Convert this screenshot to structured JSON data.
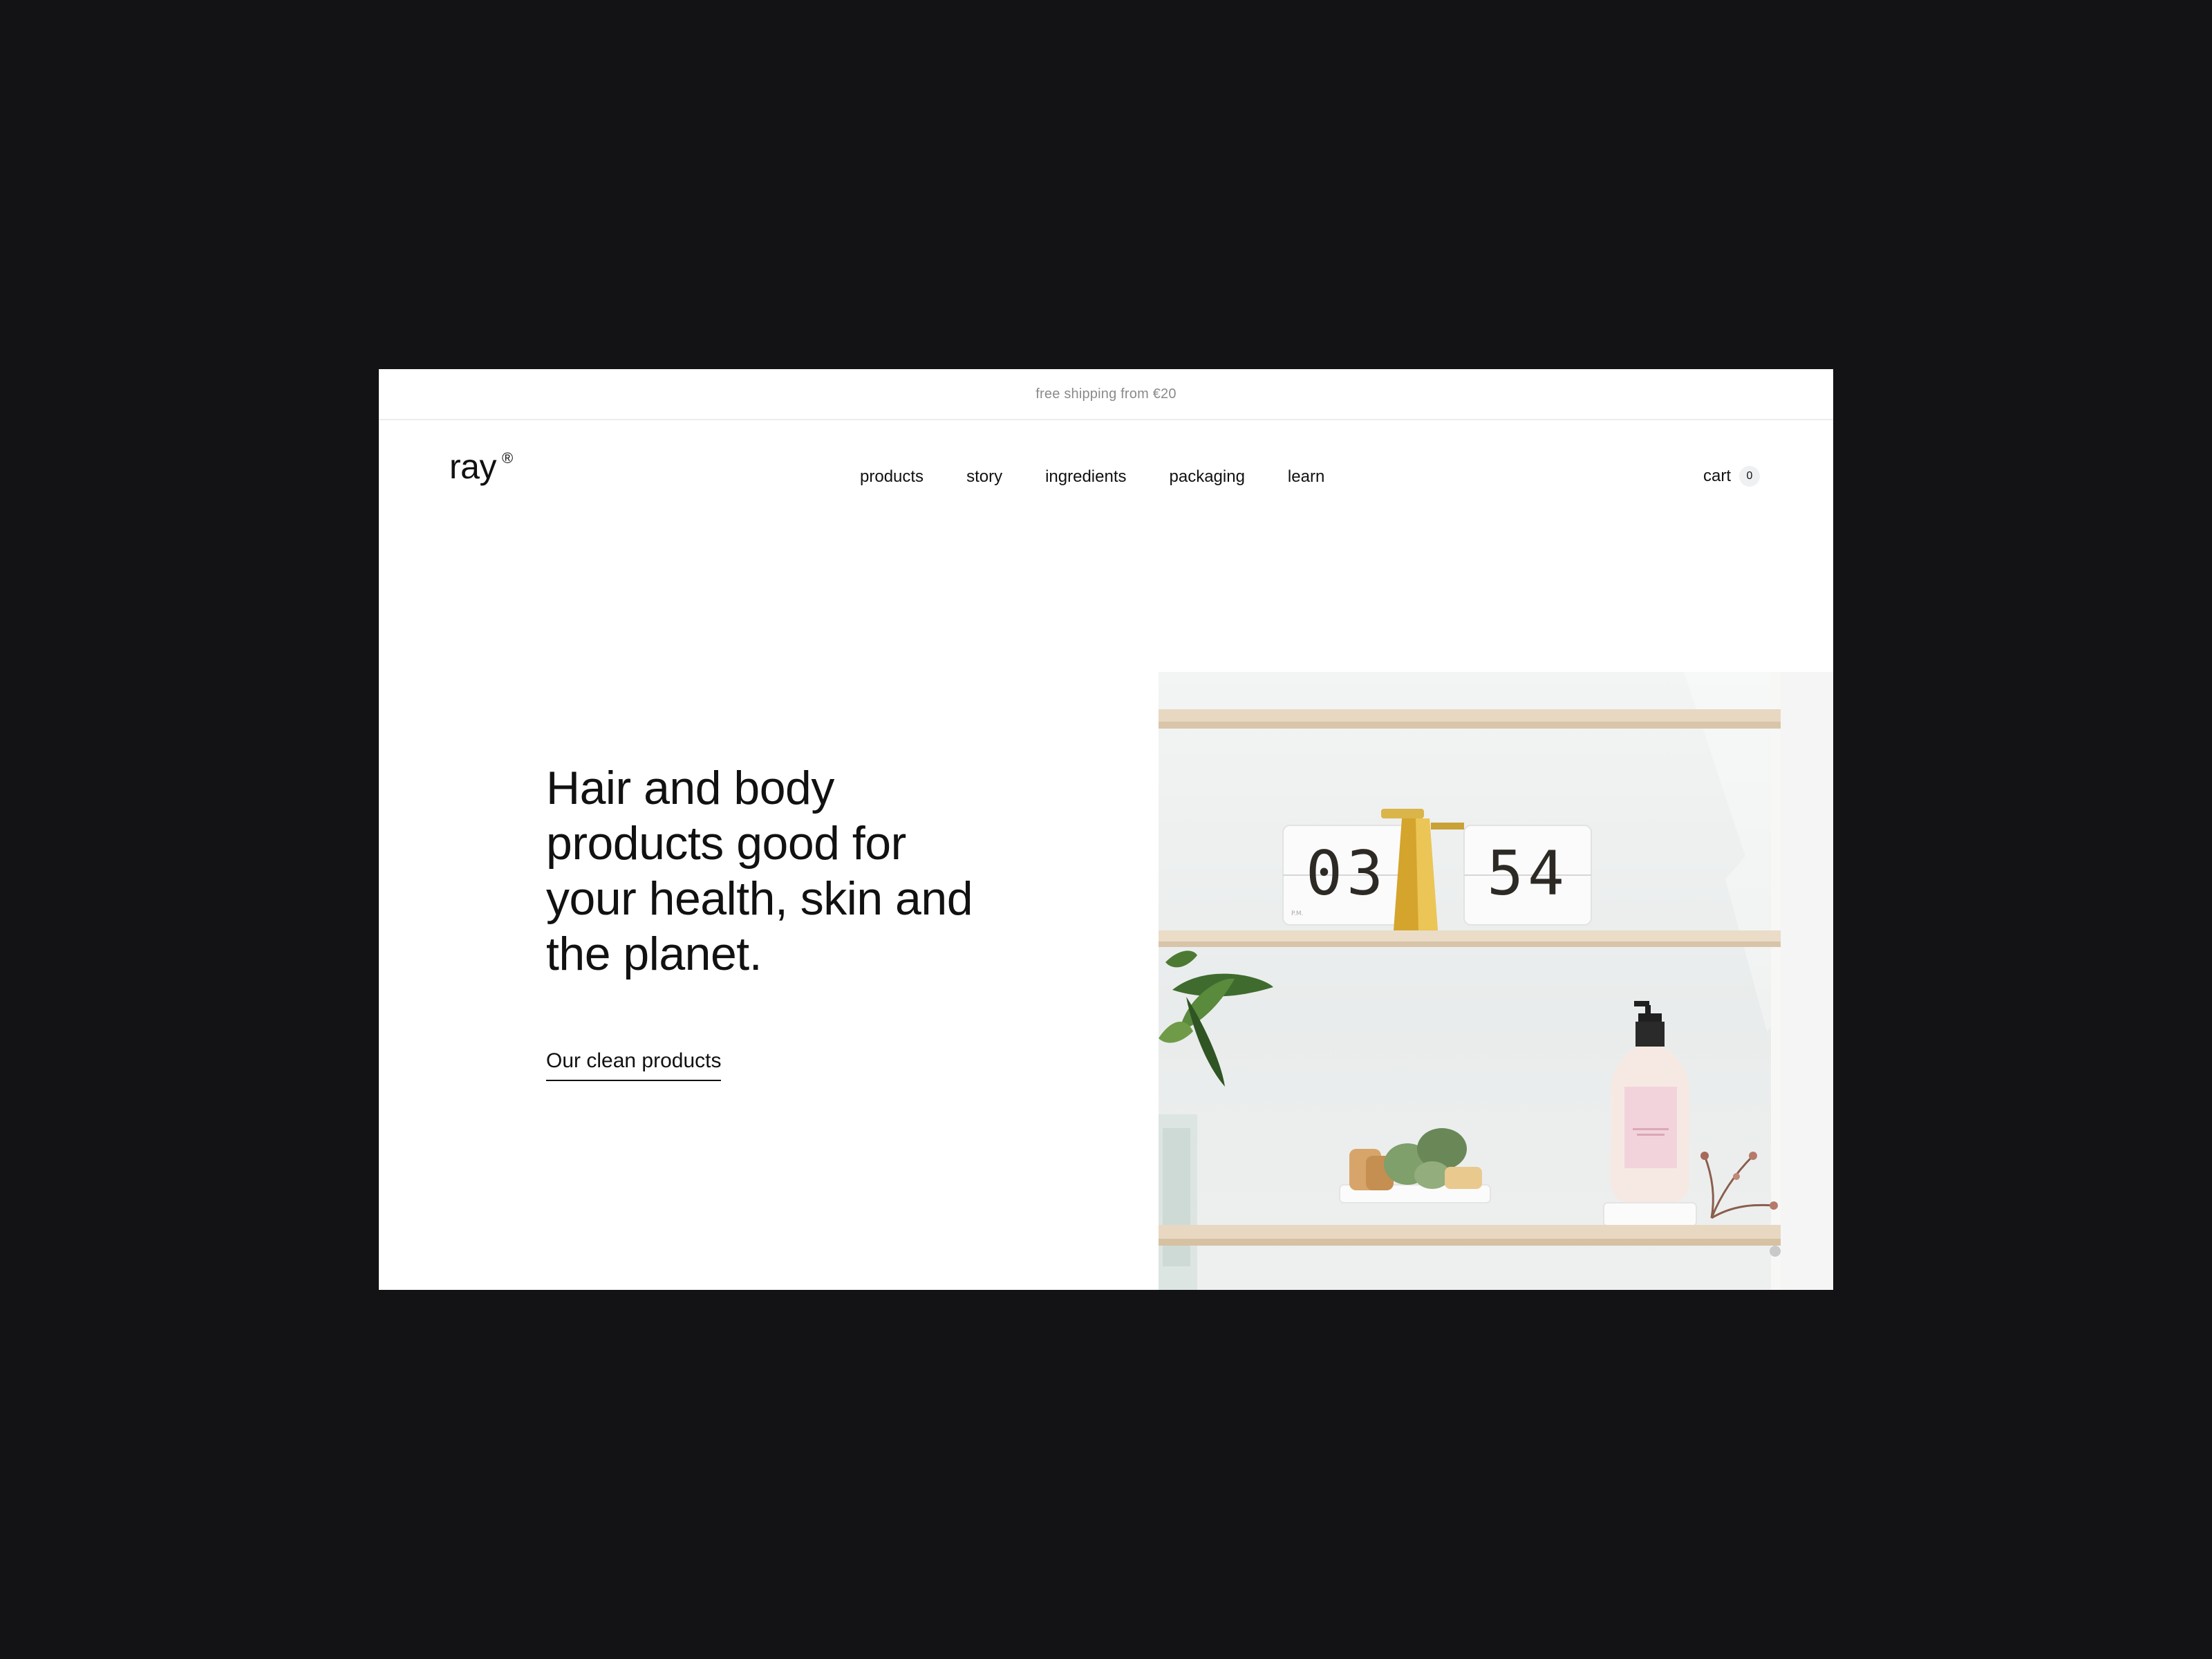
{
  "promo": {
    "text": "free shipping from €20"
  },
  "brand": {
    "name": "ray",
    "mark": "®"
  },
  "nav": {
    "items": [
      {
        "label": "products"
      },
      {
        "label": "story"
      },
      {
        "label": "ingredients"
      },
      {
        "label": "packaging"
      },
      {
        "label": "learn"
      }
    ]
  },
  "cart": {
    "label": "cart",
    "count": "0"
  },
  "hero": {
    "title": "Hair and body products good for your health, skin and the planet.",
    "cta_label": "Our clean products",
    "image": {
      "clock_hours": "03",
      "clock_minutes": "54",
      "clock_period": "P.M."
    }
  },
  "colors": {
    "background": "#131315",
    "page": "#ffffff",
    "text": "#111111",
    "muted": "#8a8a8a",
    "shelf_wood": "#e7d6bd"
  }
}
